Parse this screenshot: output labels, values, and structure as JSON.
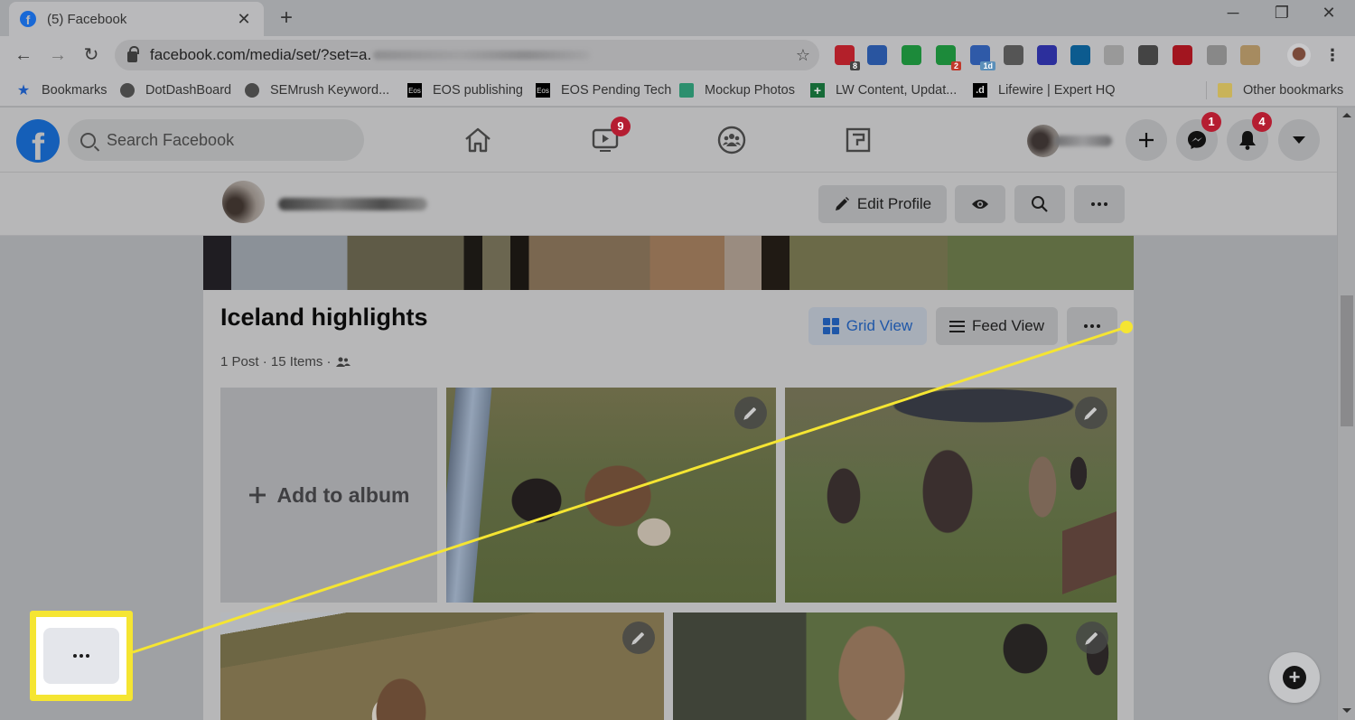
{
  "browser": {
    "tab": {
      "title": "(5) Facebook",
      "favicon": "facebook-icon"
    },
    "new_tab_label": "+",
    "window_controls": {
      "minimize": "─",
      "restore": "❐",
      "close": "✕"
    },
    "nav": {
      "back": "←",
      "forward": "→",
      "reload": "↻"
    },
    "url": "facebook.com/media/set/?set=a.",
    "url_redacted": true,
    "extensions": [
      {
        "name": "todoist-extension-icon",
        "badge": "8",
        "color": "#b3202a"
      },
      {
        "name": "vivaldi-v-extension-icon",
        "badge": "",
        "color": "#2955a0"
      },
      {
        "name": "evernote-extension-icon",
        "badge": "",
        "color": "#1c8a3a"
      },
      {
        "name": "grammar-extension-icon",
        "badge": "2",
        "color": "#1c8a3a"
      },
      {
        "name": "calendar-extension-icon",
        "badge": "1d",
        "color": "#2f5aa8"
      },
      {
        "name": "pen-extension-icon",
        "badge": "",
        "color": "#555"
      },
      {
        "name": "vimeo-extension-icon",
        "badge": "",
        "color": "#2c2f9c"
      },
      {
        "name": "circle-extension-icon",
        "badge": "",
        "color": "#0c5b8f"
      },
      {
        "name": "calculator-extension-icon",
        "badge": "",
        "color": "#999"
      },
      {
        "name": "lens-extension-icon",
        "badge": "",
        "color": "#444"
      },
      {
        "name": "mcafee-extension-icon",
        "badge": "",
        "color": "#a2151f"
      },
      {
        "name": "abp-extension-icon",
        "badge": "",
        "color": "#888"
      },
      {
        "name": "clipboard-extension-icon",
        "badge": "",
        "color": "#a68b60"
      }
    ],
    "bookmarks": [
      {
        "label": "Bookmarks",
        "icon": "star-icon"
      },
      {
        "label": "DotDashBoard",
        "icon": "globe-icon"
      },
      {
        "label": "SEMrush Keyword...",
        "icon": "globe-icon"
      },
      {
        "label": "EOS publishing",
        "icon": "eos-icon"
      },
      {
        "label": "EOS Pending Tech",
        "icon": "eos-icon"
      },
      {
        "label": "Mockup Photos",
        "icon": "photos-icon"
      },
      {
        "label": "LW Content, Updat...",
        "icon": "sheets-icon"
      },
      {
        "label": "Lifewire | Expert HQ",
        "icon": "dotdash-icon"
      }
    ],
    "other_bookmarks": "Other bookmarks",
    "eos_glyph": "Eos",
    "dotdash_glyph": ".d"
  },
  "facebook": {
    "search_placeholder": "Search Facebook",
    "nav_badges": {
      "watch": "9"
    },
    "header_badges": {
      "messenger": "1",
      "notifications": "4"
    },
    "profile_name_redacted": true,
    "profile_actions": {
      "edit_profile": "Edit Profile"
    },
    "album": {
      "title": "Iceland highlights",
      "meta": "1 Post · 15 Items ·",
      "grid_view": "Grid View",
      "feed_view": "Feed View",
      "add_to_album": "Add to album",
      "photo_count_visible": 4
    },
    "callout_highlight": "more-options-button"
  },
  "colors": {
    "facebook_blue": "#1877f2",
    "badge_red": "#b51d31",
    "callout_yellow": "#f5e532"
  }
}
